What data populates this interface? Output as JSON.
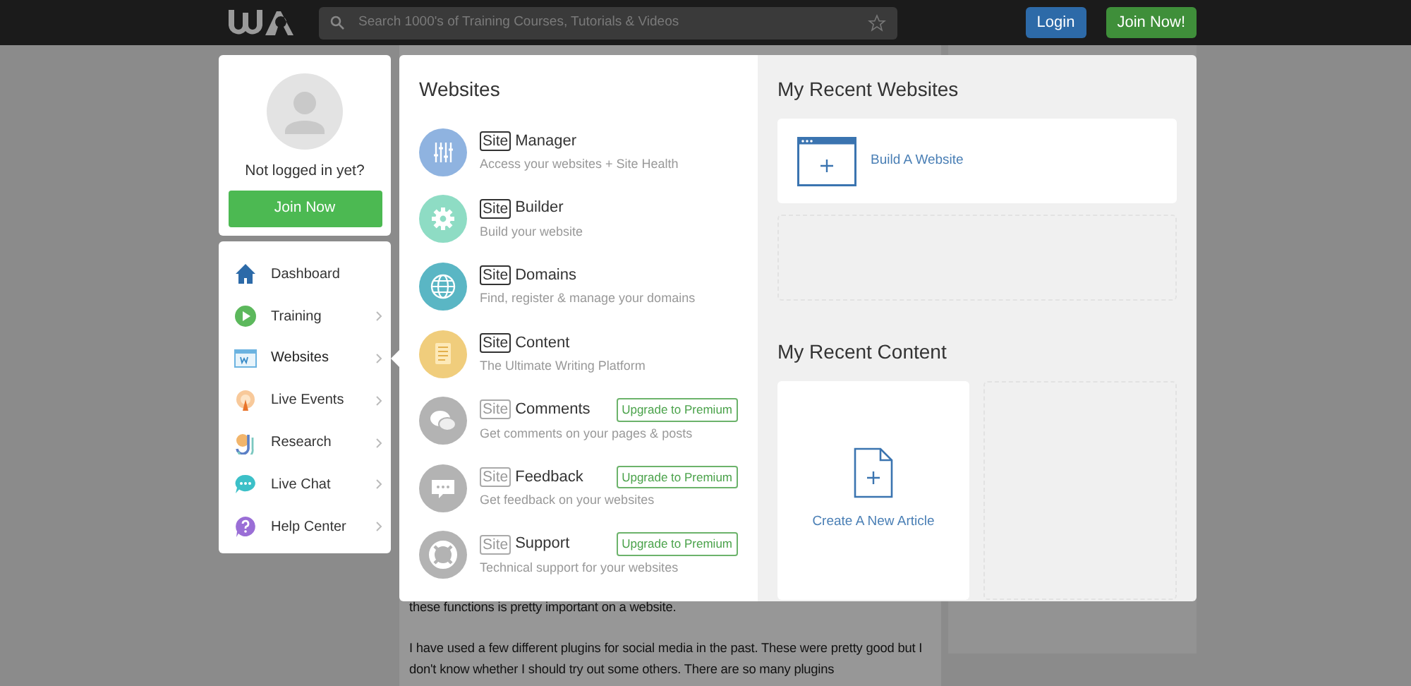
{
  "top_bar": {
    "search": {
      "placeholder": "Search 1000's of Training Courses, Tutorials & Videos"
    },
    "buttons": [
      {
        "label": "Login",
        "kind": "login"
      },
      {
        "label": "Join Now!",
        "kind": "join"
      }
    ]
  },
  "background_article": {
    "paragraphs": [
      "these functions is pretty important on a website.",
      "I have used a few different plugins for social media in the past. These were pretty good but I don't know whether I should try out some others. There are so many plugins"
    ]
  },
  "profile": {
    "prompt": "Not logged in yet?",
    "button": "Join Now"
  },
  "sidebar": {
    "items": [
      {
        "label": "Dashboard",
        "has_submenu": false,
        "selected": false
      },
      {
        "label": "Training",
        "has_submenu": true,
        "selected": false
      },
      {
        "label": "Websites",
        "has_submenu": true,
        "selected": true
      },
      {
        "label": "Live Events",
        "has_submenu": true,
        "selected": false
      },
      {
        "label": "Research",
        "has_submenu": true,
        "selected": false
      },
      {
        "label": "Live Chat",
        "has_submenu": true,
        "selected": false
      },
      {
        "label": "Help Center",
        "has_submenu": true,
        "selected": false
      }
    ]
  },
  "websites_menu": {
    "title": "Websites",
    "items": [
      {
        "prefix": "Site",
        "name": "Manager",
        "description": "Access your websites + Site Health",
        "color": "#8fb3e0",
        "kind": "available"
      },
      {
        "prefix": "Site",
        "name": "Builder",
        "description": "Build your website",
        "color": "#8edcc4",
        "kind": "available"
      },
      {
        "prefix": "Site",
        "name": "Domains",
        "description": "Find, register & manage your domains",
        "color": "#5ab6c4",
        "kind": "available"
      },
      {
        "prefix": "Site",
        "name": "Content",
        "description": "The Ultimate Writing Platform",
        "color": "#f0cd7c",
        "kind": "available"
      },
      {
        "prefix": "Site",
        "name": "Comments",
        "description": "Get comments on your pages & posts",
        "color": "#b3b3b3",
        "kind": "premium",
        "badge": "Upgrade to Premium"
      },
      {
        "prefix": "Site",
        "name": "Feedback",
        "description": "Get feedback on your websites",
        "color": "#b3b3b3",
        "kind": "premium",
        "badge": "Upgrade to Premium"
      },
      {
        "prefix": "Site",
        "name": "Support",
        "description": "Technical support for your websites",
        "color": "#b3b3b3",
        "kind": "premium",
        "badge": "Upgrade to Premium"
      }
    ]
  },
  "recent_websites": {
    "title": "My Recent Websites",
    "action": "Build A Website"
  },
  "recent_content": {
    "title": "My Recent Content",
    "action": "Create A New Article"
  }
}
